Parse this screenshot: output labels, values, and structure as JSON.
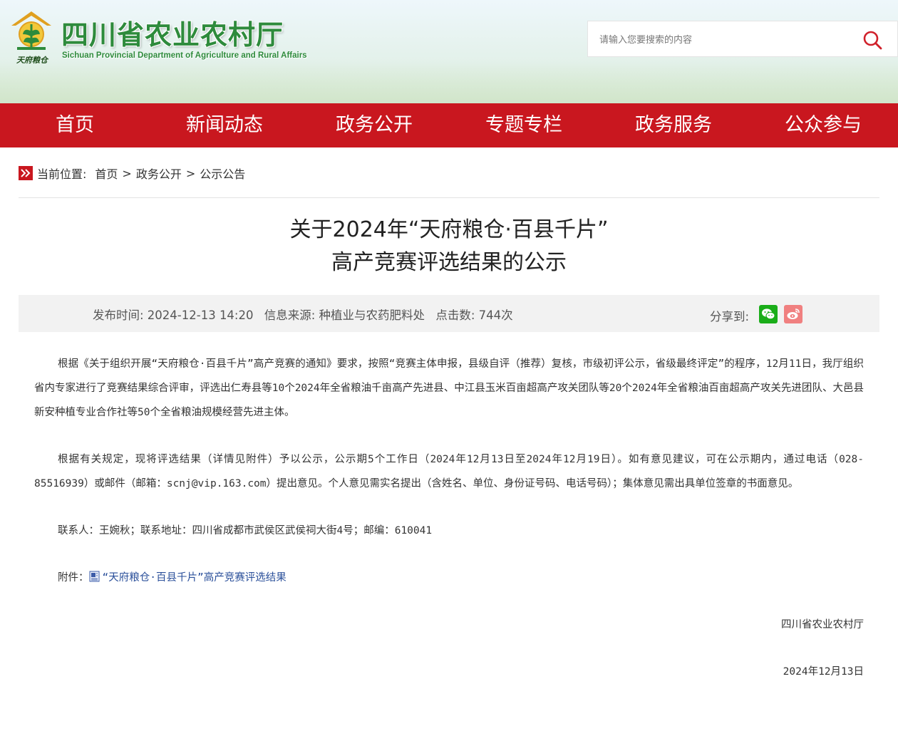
{
  "header": {
    "site_title": "四川省农业农村厅",
    "site_subtitle": "Sichuan Provincial Department of Agriculture and Rural Affairs",
    "logo_text": "天府粮仓",
    "brand_green": "#2e8b3c",
    "search": {
      "placeholder": "请输入您要搜索的内容"
    }
  },
  "nav": {
    "color": "#c9171f",
    "items": [
      "首页",
      "新闻动态",
      "政务公开",
      "专题专栏",
      "政务服务",
      "公众参与"
    ]
  },
  "breadcrumb": {
    "label": "当前位置:",
    "items": [
      "首页",
      "政务公开",
      "公示公告"
    ],
    "separator": ">"
  },
  "article": {
    "title_line1": "关于2024年“天府粮仓·百县千片”",
    "title_line2": "高产竞赛评选结果的公示",
    "meta": {
      "publish_time": "发布时间:  2024-12-13 14:20",
      "source": "信息来源:  种植业与农药肥料处",
      "clicks": "点击数:  744次",
      "share_label": "分享到:"
    },
    "paragraphs": [
      "根据《关于组织开展“天府粮仓·百县千片”高产竞赛的通知》要求，按照“竞赛主体申报，县级自评（推荐）复核，市级初评公示，省级最终评定”的程序，12月11日，我厅组织省内专家进行了竞赛结果综合评审，评选出仁寿县等10个2024年全省粮油千亩高产先进县、中江县玉米百亩超高产攻关团队等20个2024年全省粮油百亩超高产攻关先进团队、大邑县新安种植专业合作社等50个全省粮油规模经营先进主体。",
      "根据有关规定，现将评选结果（详情见附件）予以公示，公示期5个工作日（2024年12月13日至2024年12月19日）。如有意见建议，可在公示期内，通过电话（028-85516939）或邮件（邮箱：scnj@vip.163.com）提出意见。个人意见需实名提出（含姓名、单位、身份证号码、电话号码）；集体意见需出具单位签章的书面意见。",
      "联系人：王婉秋；联系地址：四川省成都市武侯区武侯祠大街4号；邮编：610041"
    ],
    "attachment_label": "附件：",
    "attachment_link": "“天府粮仓·百县千片”高产竞赛评选结果",
    "signature": "四川省农业农村厅",
    "date": "2024年12月13日"
  }
}
